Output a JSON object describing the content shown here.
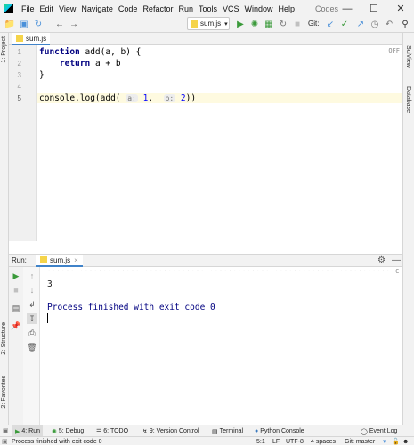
{
  "menubar": {
    "items": [
      "File",
      "Edit",
      "View",
      "Navigate",
      "Code",
      "Refactor",
      "Run",
      "Tools",
      "VCS",
      "Window",
      "Help"
    ],
    "project_name": "Codes"
  },
  "toolbar": {
    "run_config": "sum.js",
    "git_label": "Git:"
  },
  "left_stripe": {
    "project": "1: Project",
    "structure": "Z: Structure",
    "favorites": "2: Favorites"
  },
  "right_stripe": {
    "sciview": "SciView",
    "database": "Database"
  },
  "editor": {
    "tab_label": "sum.js",
    "line_numbers": [
      "1",
      "2",
      "3",
      "4",
      "5"
    ],
    "line1_kw": "function",
    "line1_rest": " add(a, b) {",
    "line2_kw": "return",
    "line2_rest": " a + b",
    "line3": "}",
    "line5_prefix": "console.log(add( ",
    "hint_a": "a:",
    "arg1": "1",
    "comma": ",  ",
    "hint_b": "b:",
    "arg2": "2",
    "line5_suffix": "))",
    "inspection": "OFF"
  },
  "run_panel": {
    "title": "Run:",
    "tab_label": "sum.js",
    "command_line": "·········································································· Comman\\",
    "output": "3",
    "exit_message": "Process finished with exit code 0"
  },
  "bottom_tools": {
    "run": "4: Run",
    "debug": "5: Debug",
    "todo": "6: TODO",
    "vcs": "9: Version Control",
    "terminal": "Terminal",
    "python_console": "Python Console",
    "event_log": "Event Log"
  },
  "status_bar": {
    "message": "Process finished with exit code 0",
    "position": "5:1",
    "line_sep": "LF",
    "encoding": "UTF-8",
    "indent": "4 spaces",
    "branch": "Git: master"
  },
  "colors": {
    "keyword": "#000080",
    "number": "#0000ff",
    "console_info": "#000080",
    "accent": "#4083c9"
  }
}
